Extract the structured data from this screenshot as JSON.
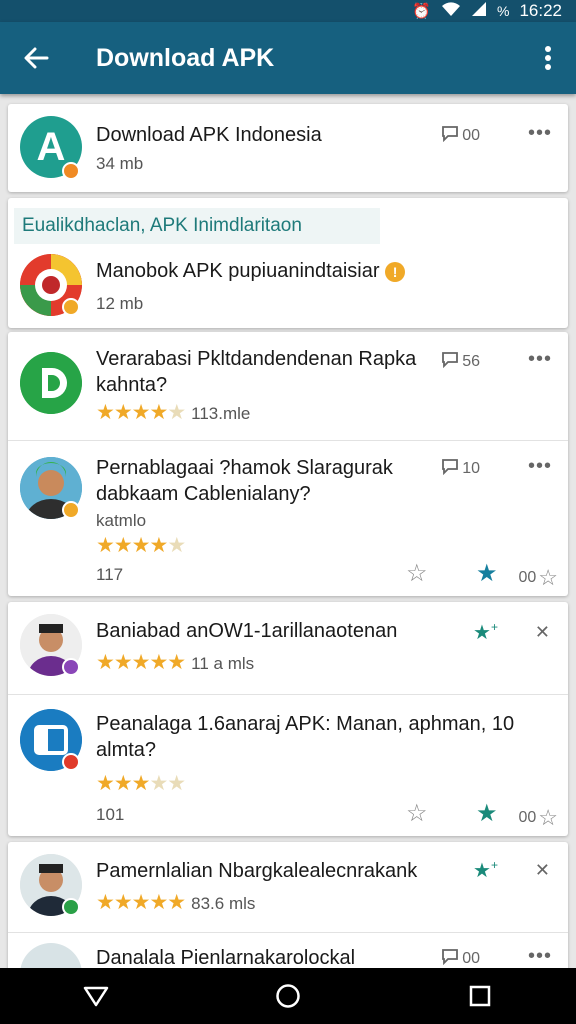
{
  "status_bar": {
    "signal_text": "%",
    "time": "16:22"
  },
  "app_bar": {
    "title": "Download APK"
  },
  "top_card": {
    "title": "Download APK Indonesia",
    "meta": "34 mb",
    "count": "00",
    "avatar_letter": "A"
  },
  "section": {
    "label": "Eualikdhaclan, APK Inimdlaritaon",
    "item": {
      "title": "Manobok APK pupiuanindtaisiar",
      "meta": "12 mb"
    }
  },
  "card_b": [
    {
      "title": "Verarabasi Pkltdandendenan Rapka kahnta?",
      "rating": 4.5,
      "meta": "113.mle",
      "count": "56"
    },
    {
      "title": "Pernablagaai ?hamok Slaragurak dabkaam Cablenialany?",
      "subtitle": "katmlo",
      "rating": 4.5,
      "meta": "117",
      "count": "10",
      "star_count": "00"
    }
  ],
  "card_c": [
    {
      "title": "Baniabad anOW1-1arillanaotenan",
      "rating": 5,
      "meta": "11 a mls"
    },
    {
      "title": "Peanalaga 1.6anaraj APK: Manan, aphman, 10 almta?",
      "rating": 3,
      "meta": "101",
      "star_count": "00"
    }
  ],
  "card_d": [
    {
      "title": "Pamernlalian Nbargkalealecnrakank",
      "rating": 5,
      "meta": "83.6 mls"
    },
    {
      "title": "Danalala Pienlarnakarolockal",
      "count": "00"
    }
  ],
  "colors": {
    "app_bar": "#16607f",
    "status_bar": "#14506c",
    "star": "#f0a928",
    "accent": "#1e7a7a"
  }
}
